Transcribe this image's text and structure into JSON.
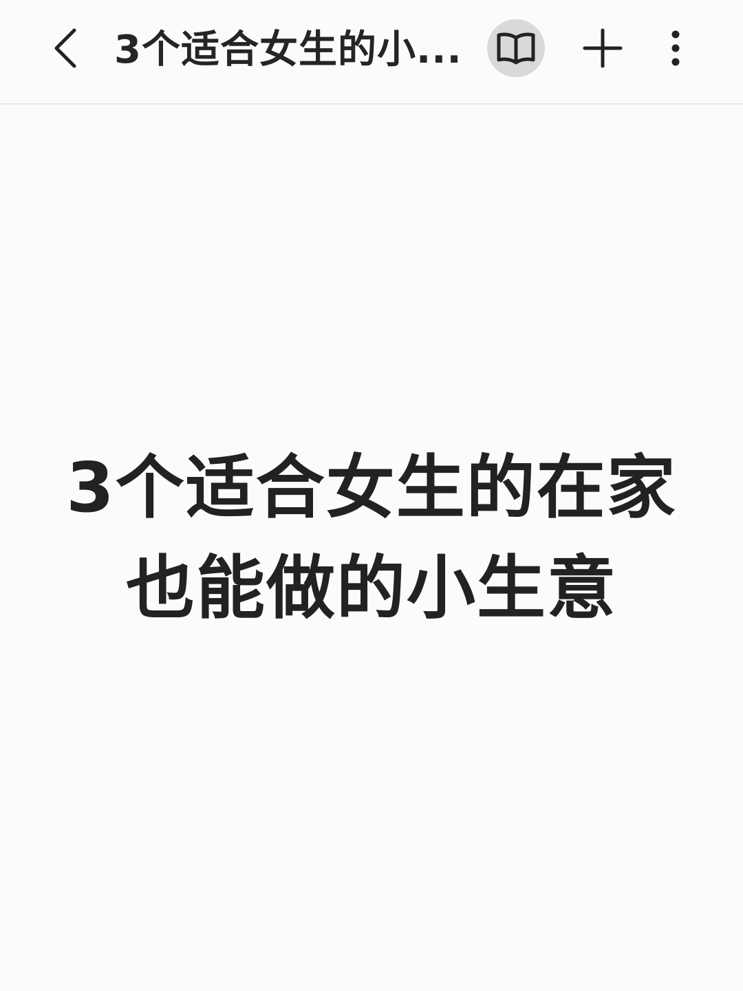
{
  "header": {
    "title": "3个适合女生的小...",
    "back_icon": "chevron-left-icon",
    "reader_icon": "open-book-icon",
    "add_icon": "plus-icon",
    "more_icon": "more-vertical-icon"
  },
  "content": {
    "headline_line1": "3个适合女生的在家",
    "headline_line2": "也能做的小生意"
  },
  "colors": {
    "background": "#fbfbfb",
    "text": "#222222",
    "reader_button_bg": "#d9d9d9",
    "divider": "#e6e6e6"
  }
}
